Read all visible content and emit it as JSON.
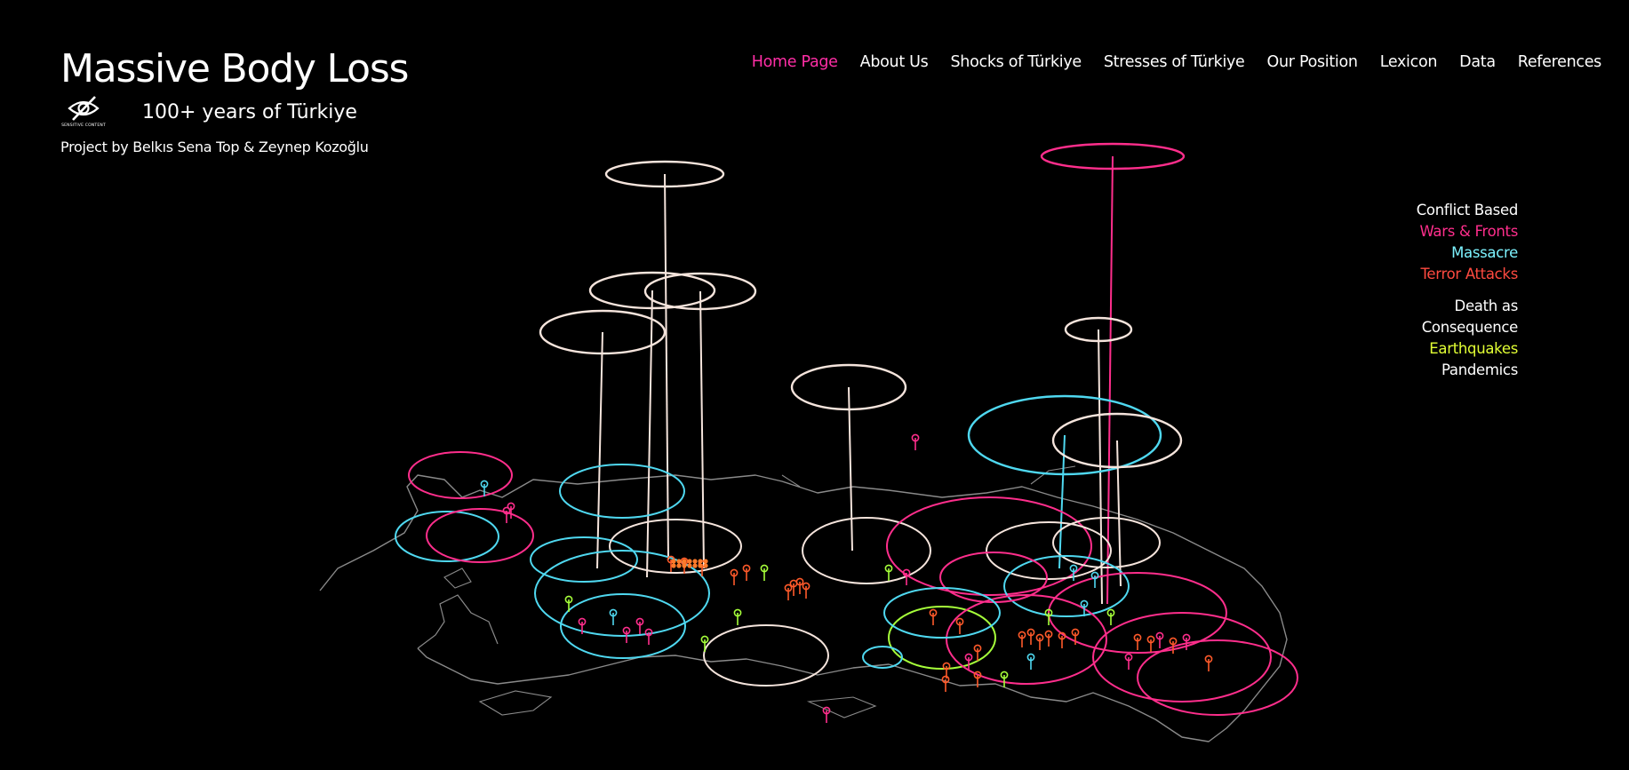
{
  "header": {
    "title": "Massive Body Loss",
    "subtitle": "100+ years of Türkiye",
    "credits": "Project by Belkıs Sena Top & Zeynep Kozoğlu",
    "sensitive_badge": {
      "icon": "eye-slash-icon",
      "label": "SENSITIVE CONTENT"
    }
  },
  "nav": {
    "items": [
      {
        "label": "Home Page",
        "active": true
      },
      {
        "label": "About Us"
      },
      {
        "label": "Shocks of Türkiye"
      },
      {
        "label": "Stresses of Türkiye"
      },
      {
        "label": "Our Position"
      },
      {
        "label": "Lexicon"
      },
      {
        "label": "Data"
      },
      {
        "label": "References"
      }
    ]
  },
  "legend": {
    "conflict": {
      "heading": "Conflict Based",
      "items": [
        "Wars & Fronts",
        "Massacre",
        "Terror Attacks"
      ]
    },
    "consequence": {
      "heading_line1": "Death as",
      "heading_line2": "Consequence",
      "items": [
        "Earthquakes",
        "Pandemics"
      ]
    }
  },
  "colors": {
    "background": "#000000",
    "wars_fronts": "#ff2e8c",
    "massacre": "#4fd8f0",
    "terror_attacks": "#ff5a2a",
    "earthquakes": "#a6ff3a",
    "pandemics": "#f5e4dc",
    "map_outline": "#8a8a8a",
    "active_nav": "#ff2ea6"
  }
}
